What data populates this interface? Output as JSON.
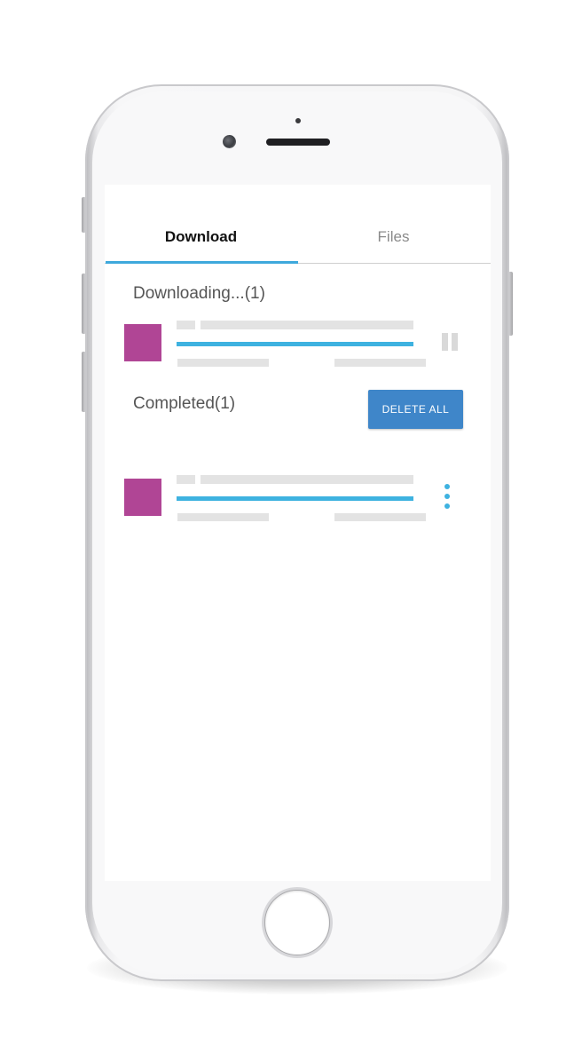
{
  "tabs": {
    "download_label": "Download",
    "files_label": "Files",
    "active": "Download"
  },
  "downloading": {
    "title": "Downloading...(1)",
    "item": {
      "progress_fraction": 1.0,
      "state": "downloading",
      "thumbnail_color": "#b04595",
      "action_icon": "pause-icon"
    }
  },
  "completed": {
    "title": "Completed(1)",
    "delete_all_label": "DELETE ALL",
    "item": {
      "progress_fraction": 1.0,
      "state": "completed",
      "thumbnail_color": "#b04595",
      "action_icon": "more-vert-icon"
    }
  },
  "colors": {
    "accent": "#3eb2e0",
    "button": "#3f86c9",
    "thumbnail": "#b04595",
    "placeholder": "#e3e3e3"
  }
}
